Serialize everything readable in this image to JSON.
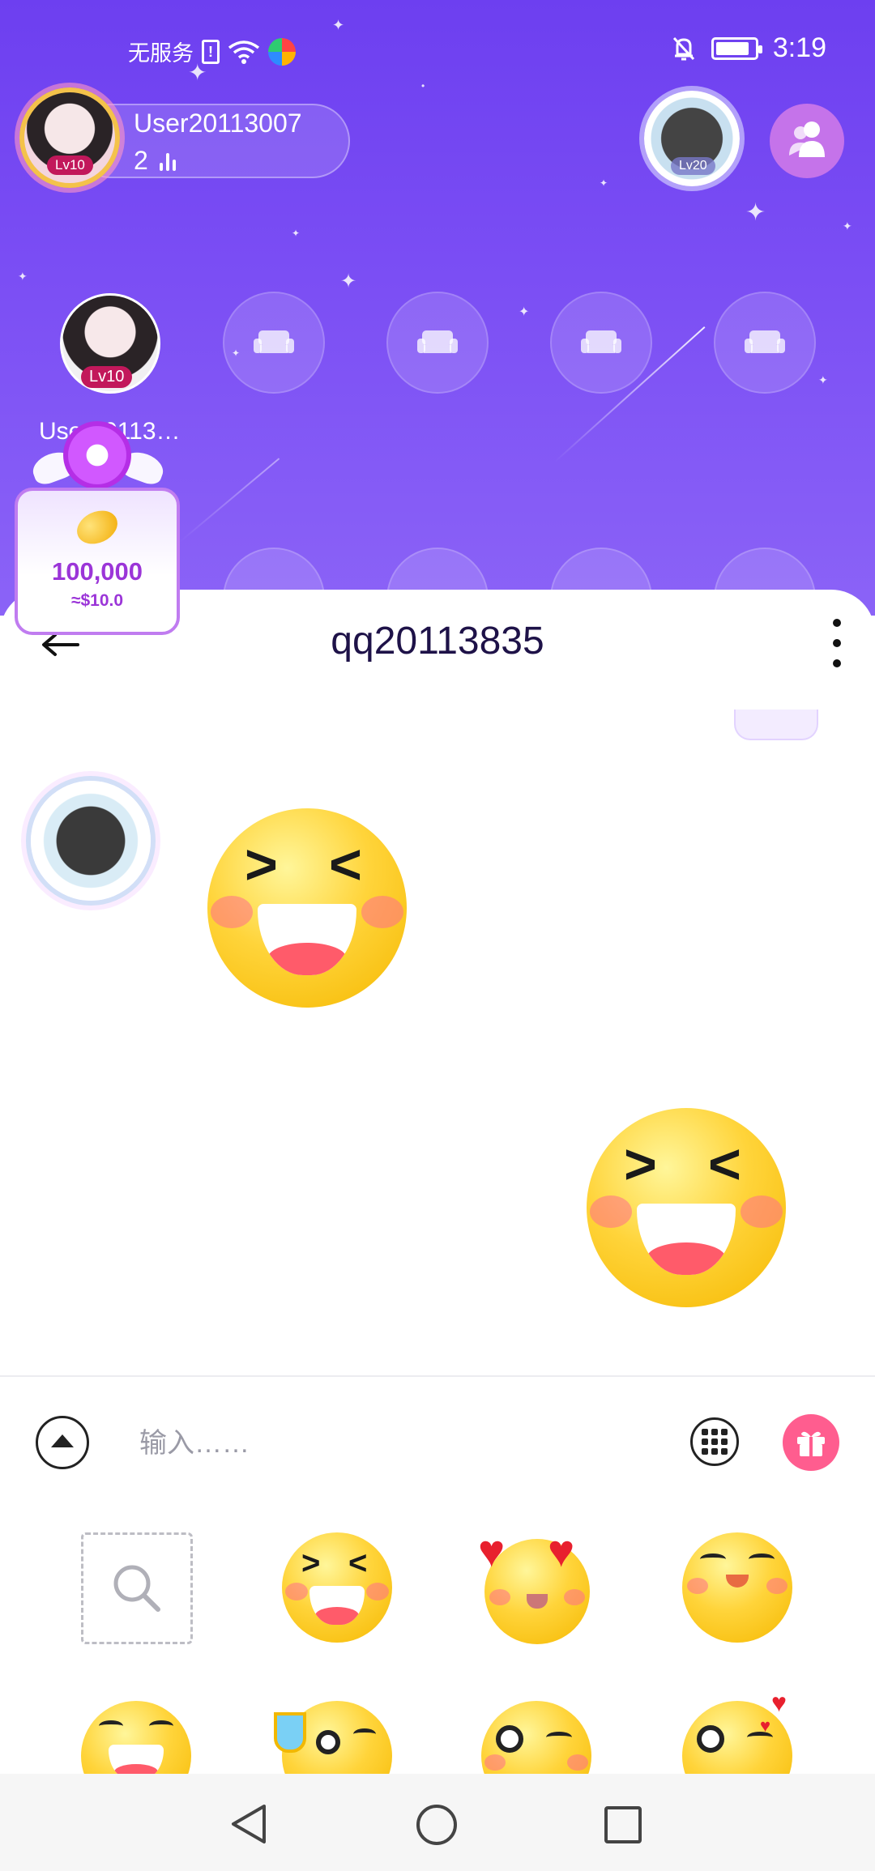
{
  "status_bar": {
    "carrier": "无服务",
    "time": "3:19"
  },
  "room": {
    "owner": {
      "name": "User20113007",
      "level": "Lv10",
      "count": "2"
    },
    "host": {
      "level": "Lv20"
    },
    "seat_user": {
      "level": "Lv10",
      "name": "User20113…"
    },
    "gift_popup": {
      "amount": "100,000",
      "usd": "≈$10.0"
    }
  },
  "chat": {
    "title": "qq20113835",
    "input_placeholder": "输入……"
  },
  "icons": {
    "back": "back-arrow-icon",
    "more": "more-vertical-icon",
    "expand": "expand-up-icon",
    "keyboard": "keyboard-icon",
    "gift": "gift-icon",
    "search": "search-icon",
    "members": "members-icon",
    "seat": "sofa-icon"
  },
  "colors": {
    "room_top": "#6d3ff0",
    "accent_purple": "#9b35d8",
    "gift_pink": "#ff5d8f",
    "title_text": "#1e1248"
  }
}
